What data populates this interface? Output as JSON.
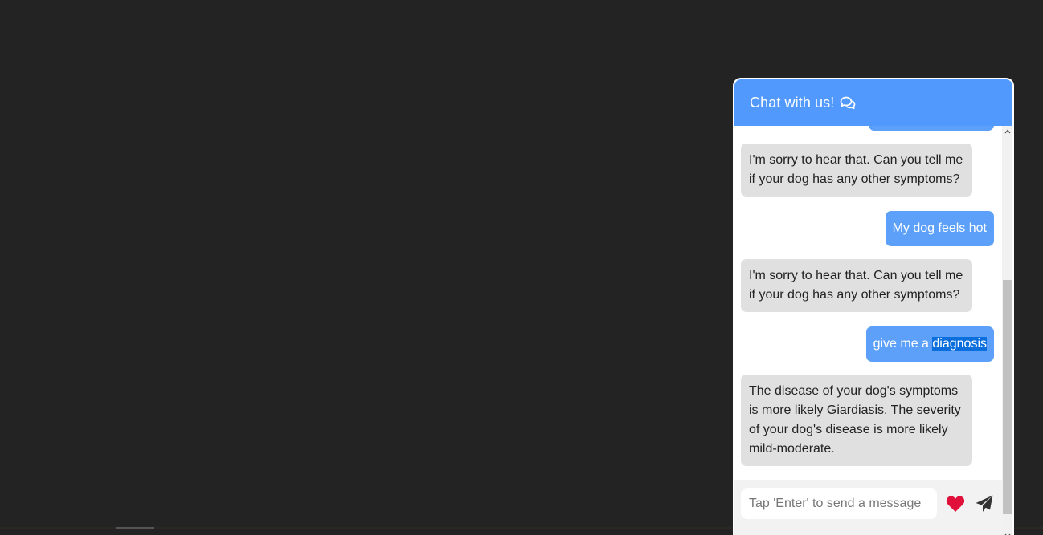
{
  "chat": {
    "title": "Chat with us!",
    "header_icon": "comments-icon",
    "accent_color": "#5199fc",
    "messages": [
      {
        "sender": "user",
        "text": ""
      },
      {
        "sender": "bot",
        "text": "I'm sorry to hear that. Can you tell me if your dog has any other symptoms?"
      },
      {
        "sender": "user",
        "text": "My dog feels hot"
      },
      {
        "sender": "bot",
        "text": "I'm sorry to hear that. Can you tell me if your dog has any other symptoms?"
      },
      {
        "sender": "user",
        "text_before": "give me a ",
        "text_highlight": "diagnosis"
      },
      {
        "sender": "bot",
        "text": "The disease of your dog's symptoms is more likely Giardiasis. The severity of your dog's disease is more likely mild-moderate."
      }
    ],
    "input": {
      "placeholder": "Tap 'Enter' to send a message",
      "value": ""
    },
    "actions": {
      "heart_icon": "heart-icon",
      "send_icon": "paper-plane-icon",
      "heart_color": "#e0103a"
    }
  }
}
